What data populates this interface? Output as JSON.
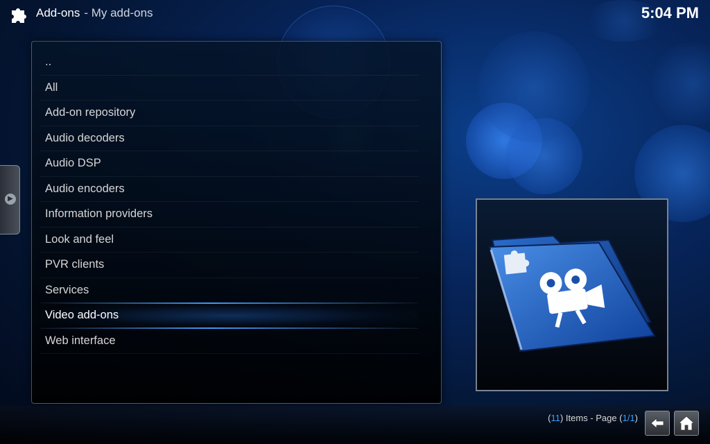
{
  "header": {
    "app_icon": "puzzle-icon",
    "section": "Add-ons",
    "subsection": "- My add-ons",
    "clock": "5:04 PM"
  },
  "list": {
    "items": [
      {
        "label": ".."
      },
      {
        "label": "All"
      },
      {
        "label": "Add-on repository"
      },
      {
        "label": "Audio decoders"
      },
      {
        "label": "Audio DSP"
      },
      {
        "label": "Audio encoders"
      },
      {
        "label": "Information providers"
      },
      {
        "label": "Look and feel"
      },
      {
        "label": "PVR clients"
      },
      {
        "label": "Services"
      },
      {
        "label": "Video add-ons"
      },
      {
        "label": "Web interface"
      }
    ],
    "selected_index": 10
  },
  "preview": {
    "icon": "video-addons-folder-icon"
  },
  "footer": {
    "count": "11",
    "items_text": " Items - Page ",
    "page": "1/1",
    "back_icon": "back-arrow-icon",
    "home_icon": "home-icon"
  },
  "colors": {
    "accent": "#3aa0ff",
    "background": "#07245a"
  }
}
